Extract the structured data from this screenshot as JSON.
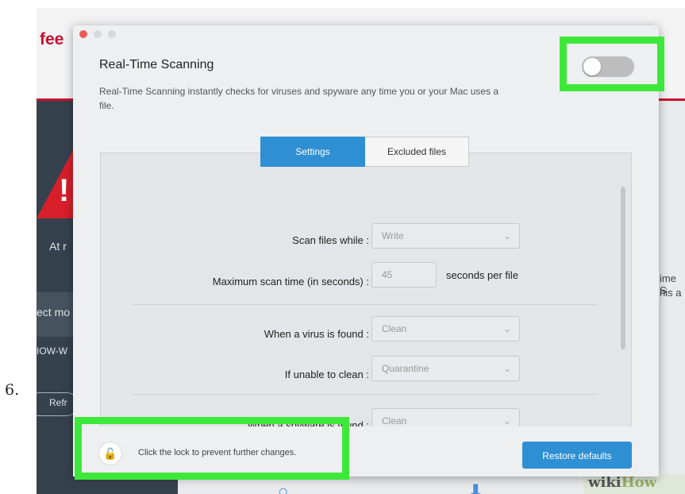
{
  "step_number": "6.",
  "background": {
    "logo_text": "fee",
    "sidebar_texts": [
      "At r",
      "ect mo",
      "IOW-W",
      "Refr"
    ],
    "right_texts": [
      "ime S",
      "his a"
    ],
    "watermark": {
      "part1": "wiki",
      "part2": "How"
    }
  },
  "modal": {
    "title": "Real-Time Scanning",
    "description": "Real-Time Scanning instantly checks for viruses and spyware any time you or your Mac uses a file.",
    "toggle_state": "off",
    "tabs": [
      {
        "label": "Settings",
        "active": true
      },
      {
        "label": "Excluded files",
        "active": false
      }
    ],
    "settings": {
      "scan_files_while": {
        "label": "Scan files while :",
        "value": "Write"
      },
      "max_scan_time": {
        "label": "Maximum scan time (in seconds) :",
        "value": "45",
        "suffix": "seconds per file"
      },
      "virus_found": {
        "label": "When a virus is found :",
        "value": "Clean"
      },
      "unable_to_clean": {
        "label": "If unable to clean :",
        "value": "Quarantine"
      },
      "spyware_found": {
        "label": "When a spyware is found :",
        "value": "Clean"
      }
    },
    "footer": {
      "lock_text": "Click the lock to prevent further changes.",
      "restore_label": "Restore defaults"
    }
  },
  "colors": {
    "accent": "#2e8fd3",
    "highlight": "#3ee83a",
    "brand": "#c8102e"
  }
}
